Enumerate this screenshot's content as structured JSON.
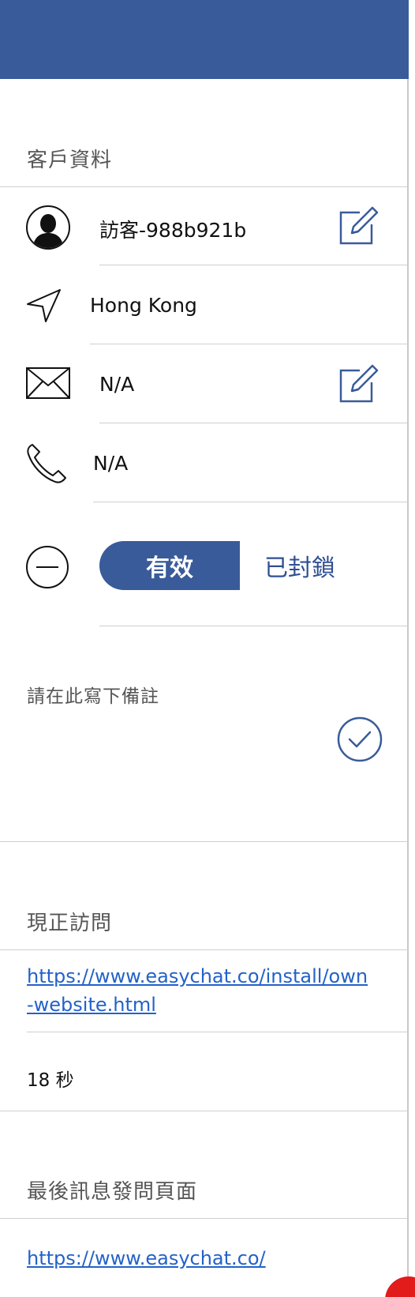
{
  "customer_section": {
    "title": "客戶資料",
    "name": "訪客-988b921b",
    "location": "Hong Kong",
    "email": "N/A",
    "phone": "N/A"
  },
  "status_toggle": {
    "active_label": "有效",
    "blocked_label": "已封鎖"
  },
  "note": {
    "placeholder": "請在此寫下備註"
  },
  "current_visit": {
    "title": "現正訪問",
    "url_line1": "https://www.easychat.co/install/own",
    "url_line2": "-website.html",
    "duration": "18 秒"
  },
  "last_message": {
    "title": "最後訊息發問頁面",
    "url": "https://www.easychat.co/"
  },
  "colors": {
    "brand": "#3a5b9a",
    "link": "#2362c8",
    "alert": "#e21b1b"
  }
}
